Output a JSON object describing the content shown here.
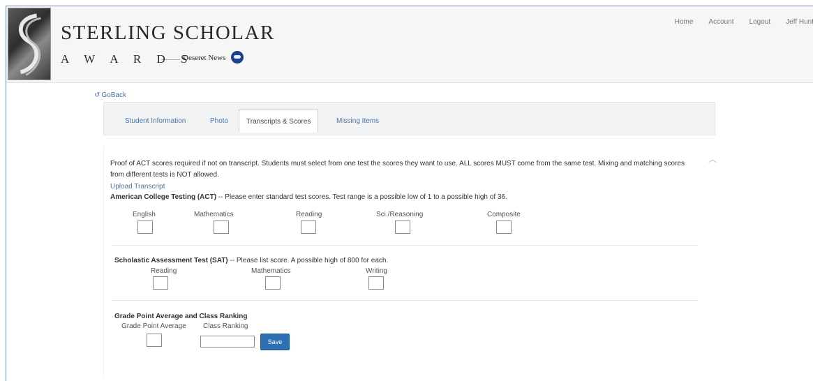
{
  "header": {
    "title": "STERLING SCHOLAR",
    "subtitle": "A W A R D S",
    "presented_by": "———",
    "sponsor": "Deseret News",
    "logo_icon": "sterling-s-logo",
    "sponsor_icon": "ksl-logo"
  },
  "topnav": {
    "home": "Home",
    "account": "Account",
    "logout": "Logout",
    "user": "Jeff Hunt"
  },
  "goback": {
    "icon": "back-arrow-icon",
    "label": "GoBack"
  },
  "tabs": [
    {
      "label": "Student Information",
      "active": false
    },
    {
      "label": "Photo",
      "active": false
    },
    {
      "label": "Transcripts & Scores",
      "active": true
    },
    {
      "label": "Missing Items",
      "active": false
    }
  ],
  "intro_text": "Proof of ACT scores required if not on transcript. Students must select from one test the scores they want to use. ALL scores MUST come from the same test. Mixing and matching scores from different tests is NOT allowed.",
  "upload_transcript": "Upload Transcript",
  "act": {
    "heading": "American College Testing (ACT)",
    "note": " -- Please enter standard test scores. Test range is a possible low of 1 to a possible high of 36.",
    "fields": [
      {
        "label": "English",
        "value": ""
      },
      {
        "label": "Mathematics",
        "value": ""
      },
      {
        "label": "Reading",
        "value": ""
      },
      {
        "label": "Sci./Reasoning",
        "value": ""
      },
      {
        "label": "Composite",
        "value": ""
      }
    ]
  },
  "sat": {
    "heading": "Scholastic Assessment Test (SAT)",
    "note": " -- Please list score. A possible high of 800 for each.",
    "fields": [
      {
        "label": "Reading",
        "value": ""
      },
      {
        "label": "Mathematics",
        "value": ""
      },
      {
        "label": "Writing",
        "value": ""
      }
    ]
  },
  "gpa": {
    "heading": "Grade Point Average and Class Ranking",
    "gpa_label": "Grade Point Average",
    "rank_label": "Class Ranking",
    "gpa_value": "",
    "rank_value": ""
  },
  "save_label": "Save"
}
